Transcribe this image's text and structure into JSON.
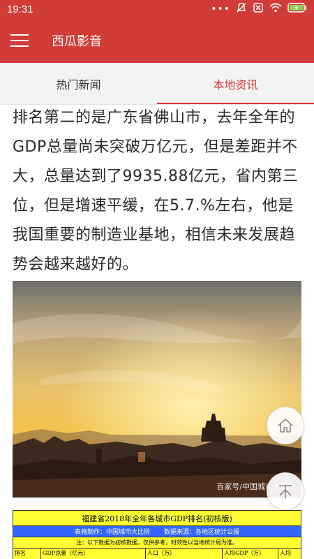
{
  "status_bar": {
    "time": "19:31",
    "icons": [
      "dots-icon",
      "mute-icon",
      "sim-off-icon",
      "wifi-icon",
      "battery-charging-icon"
    ]
  },
  "app_bar": {
    "title": "西瓜影音",
    "menu_icon": "hamburger-menu-icon",
    "background_color": "#d23c36"
  },
  "tabs": [
    {
      "label": "热门新闻",
      "active": false
    },
    {
      "label": "本地资讯",
      "active": true
    }
  ],
  "article": {
    "paragraph": "排名第二的是广东省佛山市，去年全年的GDP总量尚未突破万亿元，但是差距并不大，总量达到了9935.88亿元，省内第三位，但是增速平缓，在5.7.%左右，他是我国重要的制造业基地，相信未来发展趋势会越来越好的。",
    "photo_watermark": "百家号/中国城市大比拼"
  },
  "table_image": {
    "title": "福建省2018年全年各城市GDP排名(初核版)",
    "maker": "表格制作：中国城市大比拼",
    "source": "数据来源：各地区统计公报",
    "note": "注：以下数据为初核数据，仅供参考，时效性以当地统计局为准。",
    "headers": [
      "排名",
      "GDP总量（亿元）",
      "人口（万）",
      "人均GDP（万）",
      "人均"
    ]
  },
  "fabs": {
    "home_icon": "home-icon",
    "down_icon": "arrow-down-icon"
  }
}
